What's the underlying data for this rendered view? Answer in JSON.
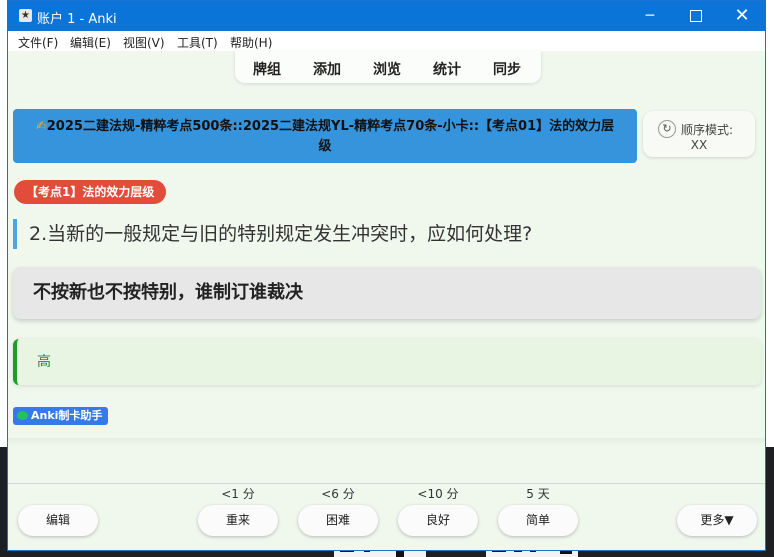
{
  "window": {
    "title": "账户 1 - Anki",
    "icon": "anki-icon",
    "controls": {
      "minimize": "─",
      "close": "✕"
    }
  },
  "menu": [
    "文件(F)",
    "编辑(E)",
    "视图(V)",
    "工具(T)",
    "帮助(H)"
  ],
  "toolbar": [
    "牌组",
    "添加",
    "浏览",
    "统计",
    "同步"
  ],
  "card": {
    "deck_icon": "✍",
    "deck_title": "2025二建法规-精粹考点500条::2025二建法规YL-精粹考点70条-小卡::【考点01】法的效力层级",
    "mode_label": "顺序模式:",
    "mode_value": "XX",
    "mode_icon": "↻",
    "tag": "【考点1】法的效力层级",
    "question": "2.当新的一般规定与旧的特别规定发生冲突时，应如何处理?",
    "answer": "不按新也不按特别，谁制订谁裁决",
    "level": "高",
    "helper_badge": "Anki制卡助手"
  },
  "bottom": {
    "edit": "编辑",
    "more": "更多▼",
    "answers": [
      {
        "interval": "<1 分",
        "label": "重来"
      },
      {
        "interval": "<6 分",
        "label": "困难"
      },
      {
        "interval": "<10 分",
        "label": "良好"
      },
      {
        "interval": "5 天",
        "label": "简单"
      }
    ]
  },
  "colors": {
    "titlebar": "#0a74d8",
    "deck_bar": "#3594dc",
    "tag": "#e14c3b",
    "level_border": "#1b9e27",
    "helper_badge": "#3579ea"
  }
}
